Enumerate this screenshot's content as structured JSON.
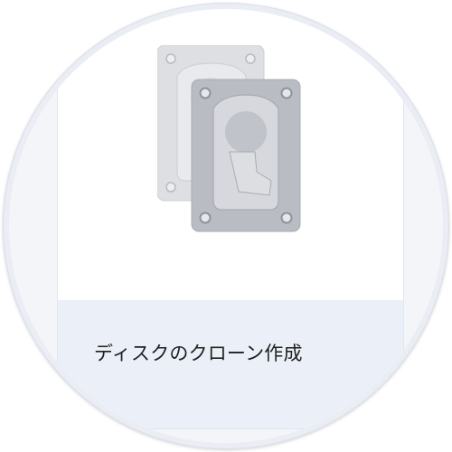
{
  "tile": {
    "label": "ディスクのクローン作成",
    "icon": "disk-clone-icon"
  },
  "colors": {
    "circle_outer": "#ebedf4",
    "circle_inner": "#f4f5f9",
    "card_background": "#ffffff",
    "footer_background": "#ebeff7",
    "disk_back": "#dcdee3",
    "disk_front": "#b9bcc3",
    "label_text": "#1f1f1f"
  }
}
